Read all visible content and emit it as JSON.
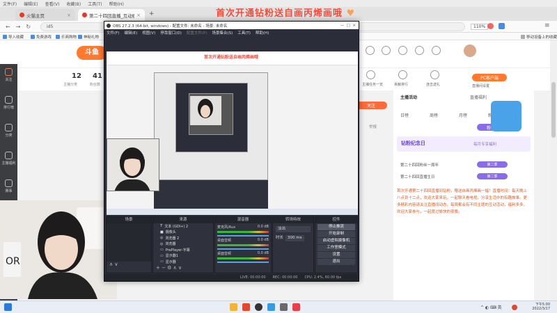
{
  "banner": {
    "text": "首次开通钻粉送自画丙烯画哦"
  },
  "browser": {
    "menu": [
      "文件(F)",
      "编辑(E)",
      "查看(V)",
      "收藏(B)",
      "工具(T)",
      "帮助(H)"
    ],
    "tabs": [
      {
        "label": "火猫主页"
      },
      {
        "label": "第二十四回直播_互动娱乐直播"
      }
    ],
    "url": "id5",
    "zoom": "110%",
    "bookmarks": [
      "导入收藏",
      "免费游戏",
      "乐商购物",
      "神秘礼物"
    ],
    "bookmarks_right": "移动设备上的收藏"
  },
  "site": {
    "logo_text": "斗鱼",
    "stats": [
      {
        "num": "12",
        "label": "主播分类"
      },
      {
        "num": "41",
        "label": "粉丝数"
      }
    ],
    "header_icons": [
      {
        "label": "1"
      },
      {
        "label": "2"
      },
      {
        "label": "3"
      },
      {
        "label": "4"
      },
      {
        "label": "5"
      }
    ],
    "header_labels": [
      "主播任务一览",
      "贡献排行",
      "连击送礼",
      "直播间设置"
    ],
    "pc_button": "PC客户端",
    "follow_button": "关注",
    "report_label": "举报",
    "left_rail": [
      "关注",
      "排行榜",
      "分类",
      "主播福利",
      "赛事"
    ],
    "right_panel": {
      "tabs": [
        "主播活动",
        "直播福利"
      ],
      "subtabs": [
        "日榜",
        "周榜",
        "月榜",
        "粉丝榜"
      ],
      "vip_title": "钻粉纪念日",
      "vip_text": "每月专享福利",
      "badge": "粉丝团",
      "rows": [
        {
          "text": "第二十四回粉丝一周年",
          "tag": "第二季"
        },
        {
          "text": "第二十四回直播生日",
          "tag": "第二季"
        }
      ],
      "notice": "首次开通第二十四回直播间钻粉，赠送自画丙烯画一幅！直播时间：每天晚上八点到十二点，欢迎大家来玩，一起聊天看电视，分享生活中的有趣故事。更多精彩内容请关注直播间动态，每周都会有不同主题的互动活动，福利多多。欢迎大家参与，一起度过愉快的夜晚。"
    }
  },
  "obs": {
    "title": "OBS 27.2.3 (64-bit, windows) - 配置文件: 未命名 - 场景: 未命名",
    "menu": [
      "文件(F)",
      "编辑(E)",
      "视图(V)",
      "停靠窗口(D)",
      "配置文件(P)",
      "场景集合(S)",
      "工具(T)",
      "帮助(H)"
    ],
    "preview_banner": "首次开通钻粉送自画丙烯画哦",
    "docks": {
      "scenes": "场景",
      "sources": "来源",
      "mixer": "混音器",
      "transitions": "转场特效",
      "controls": "控件"
    },
    "source_items": [
      "文本 (GDI+) 2",
      "摄像头",
      "浏览器 2",
      "浏览器",
      "PrePlayer-字幕",
      "显示器1",
      "显示器"
    ],
    "mixer_items": [
      {
        "name": "麦克风/Aux",
        "db": "0.0 dB"
      },
      {
        "name": "桌面音频",
        "db": "0.0 dB"
      },
      {
        "name": "桌面音频",
        "db": "0.0 dB"
      }
    ],
    "transition": {
      "type": "淡出",
      "duration_label": "时长",
      "duration": "300 ms"
    },
    "controls": [
      "停止推流",
      "开始录制",
      "启动虚拟摄像机",
      "工作室模式",
      "设置",
      "退出"
    ],
    "status": {
      "live": "LIVE: 00:00:00",
      "rec": "REC: 00:00:00",
      "cpu": "CPU: 2.4%, 60.00 fps"
    }
  },
  "taskbar": {
    "time": "下午5:00",
    "date": "2022/3/17"
  }
}
